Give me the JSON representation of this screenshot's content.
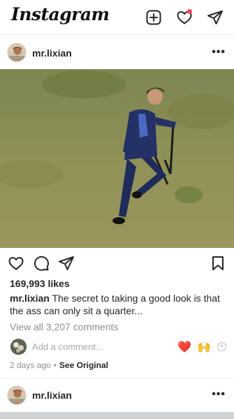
{
  "topbar": {
    "logo_text": "Instagram",
    "icons": [
      "new-post-icon",
      "activity-heart-icon",
      "direct-message-icon"
    ],
    "notification_color": "#ed4956"
  },
  "post": {
    "username": "mr.lixian",
    "more_label": "•••",
    "actions": [
      "like-heart-icon",
      "comment-icon",
      "share-icon",
      "bookmark-icon"
    ],
    "likes": "169,993 likes",
    "caption_user": "mr.lixian",
    "caption_text": " The secret to taking a good look is that the ass can only sit a quarter...",
    "view_comments": "View all 3,207 comments",
    "add_comment_placeholder": "Add a comment...",
    "quick_reactions": [
      "❤️",
      "🙌"
    ],
    "time_ago": "2 days ago",
    "separator": "•",
    "see_original": "See Original"
  },
  "next_post": {
    "username": "mr.lixian",
    "more_label": "•••"
  },
  "colors": {
    "accent_red": "#ed4956",
    "muted_text": "#8e8e8e",
    "primary_text": "#262626"
  }
}
